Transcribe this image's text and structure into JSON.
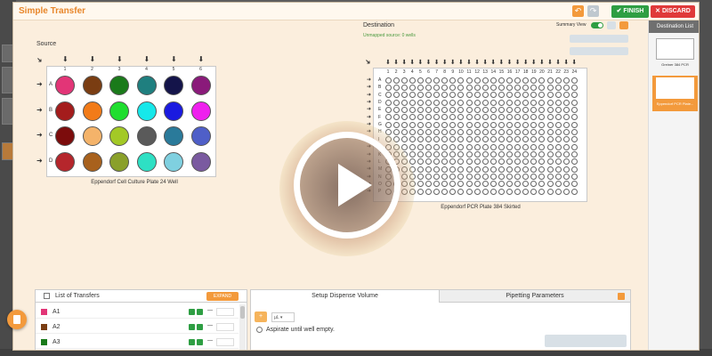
{
  "dialog": {
    "title": "Simple Transfer",
    "finish_label": "FINISH",
    "discard_label": "DISCARD"
  },
  "source": {
    "label": "Source",
    "plate_name": "Eppendorf Cell Culture Plate 24 Well",
    "columns": [
      "1",
      "2",
      "3",
      "4",
      "5",
      "6"
    ],
    "rows": [
      "A",
      "B",
      "C",
      "D"
    ],
    "well_colors": [
      [
        "#e23577",
        "#7a3d12",
        "#1a7a1a",
        "#1f7f7f",
        "#14144a",
        "#8a1a7a"
      ],
      [
        "#a41c1c",
        "#f27b18",
        "#1fde2f",
        "#16e8ea",
        "#1a1ae0",
        "#ef20ee"
      ],
      [
        "#7c0c0c",
        "#f4b36a",
        "#a3c926",
        "#5a5a5a",
        "#2a7a9a",
        "#4f5fc8"
      ],
      [
        "#b5262c",
        "#a8611d",
        "#8aa02a",
        "#2ee0c4",
        "#7fd0e0",
        "#7a5aa0"
      ]
    ]
  },
  "destination": {
    "label": "Destination",
    "unmapped_text": "Unmapped source: 0 wells",
    "summary_view_label": "Summary View",
    "plate_name": "Eppendorf PCR Plate 384 Skirted",
    "columns": [
      "1",
      "2",
      "3",
      "4",
      "5",
      "6",
      "7",
      "8",
      "9",
      "10",
      "11",
      "12",
      "13",
      "14",
      "15",
      "16",
      "17",
      "18",
      "19",
      "20",
      "21",
      "22",
      "23",
      "24"
    ],
    "rows": [
      "A",
      "B",
      "C",
      "D",
      "E",
      "F",
      "G",
      "H",
      "I",
      "J",
      "K",
      "L",
      "M",
      "N",
      "O",
      "P"
    ]
  },
  "destination_list": {
    "header": "Destination List",
    "items": [
      {
        "label": "Greiner 384 PCR",
        "selected": false
      },
      {
        "label": "Eppendorf PCR Plate...",
        "selected": true
      }
    ]
  },
  "transfers": {
    "title": "List of Transfers",
    "expand_label": "EXPAND",
    "rows": [
      {
        "name": "A1",
        "color": "#e23577"
      },
      {
        "name": "A2",
        "color": "#7a3d12"
      },
      {
        "name": "A3",
        "color": "#1a7a1a"
      }
    ]
  },
  "dispense": {
    "tab_active": "Setup Dispense Volume",
    "tab_inactive": "Pipetting Parameters",
    "unit": "µL",
    "aspirate_label": "Aspirate until well empty."
  },
  "colors": {
    "accent": "#f39a3c",
    "success": "#2e9e43",
    "danger": "#e03a3a",
    "dialog_bg": "#fbeedd"
  }
}
